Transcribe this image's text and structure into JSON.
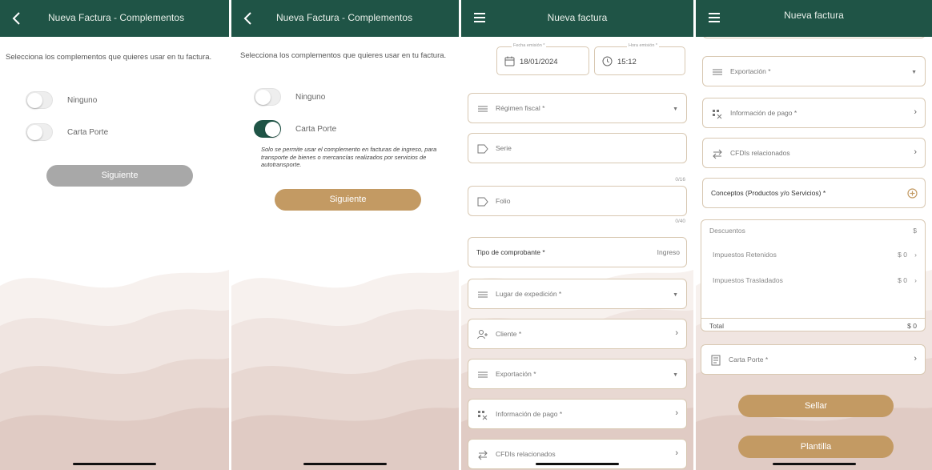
{
  "colors": {
    "header": "#1f5446",
    "accent_gold": "#c39a63",
    "border": "#d8c8b2",
    "disabled": "#a8a8a8"
  },
  "screen1": {
    "title": "Nueva Factura - Complementos",
    "instructions": "Selecciona los complementos que quieres usar en tu factura.",
    "options": [
      {
        "label": "Ninguno",
        "on": false
      },
      {
        "label": "Carta Porte",
        "on": false
      }
    ],
    "next_label": "Siguiente"
  },
  "screen2": {
    "title": "Nueva Factura - Complementos",
    "instructions": "Selecciona los complementos que quieres usar en tu factura.",
    "options": [
      {
        "label": "Ninguno",
        "on": false
      },
      {
        "label": "Carta Porte",
        "on": true
      }
    ],
    "note": "Solo se permite usar el complemento en facturas de ingreso, para transporte de bienes o mercancías realizados por servicios de autotransporte.",
    "next_label": "Siguiente"
  },
  "screen3": {
    "title": "Nueva factura",
    "fecha_label": "Fecha emisión *",
    "fecha_value": "18/01/2024",
    "hora_label": "Hora emisión *",
    "hora_value": "15:12",
    "regimen": "Régimen fiscal *",
    "serie": "Serie",
    "serie_counter": "0/16",
    "folio": "Folio",
    "folio_counter": "0/40",
    "tipo_label": "Tipo de comprobante *",
    "tipo_value": "Ingreso",
    "lugar": "Lugar de expedición *",
    "cliente": "Cliente *",
    "exportacion": "Exportación *",
    "info_pago": "Información de pago *",
    "cfdis": "CFDIs relacionados"
  },
  "screen4": {
    "title": "Nueva factura",
    "exportacion": "Exportación *",
    "info_pago": "Información de pago *",
    "cfdis": "CFDIs relacionados",
    "conceptos": "Conceptos (Productos y/o Servicios) *",
    "descuentos_label": "Descuentos",
    "descuentos_value": "$",
    "retenidos_label": "Impuestos Retenidos",
    "retenidos_value": "$ 0",
    "trasladados_label": "Impuestos Trasladados",
    "trasladados_value": "$ 0",
    "total_label": "Total",
    "total_value": "$ 0",
    "carta_porte": "Carta Porte *",
    "sellar_label": "Sellar",
    "plantilla_label": "Plantilla"
  }
}
